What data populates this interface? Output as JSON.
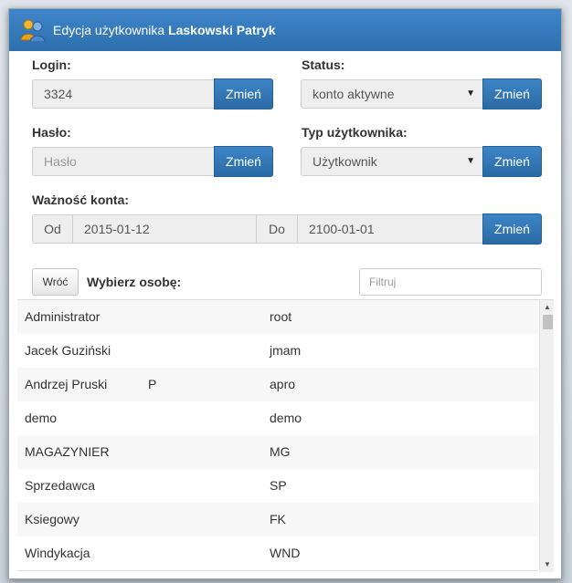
{
  "dialog": {
    "title_prefix": "Edycja użytkownika",
    "title_user": "Laskowski Patryk"
  },
  "form": {
    "login_label": "Login:",
    "login_value": "3324",
    "status_label": "Status:",
    "status_value": "konto aktywne",
    "password_label": "Hasło:",
    "password_placeholder": "Hasło",
    "user_type_label": "Typ użytkownika:",
    "user_type_value": "Użytkownik",
    "validity_label": "Ważność konta:",
    "from_label": "Od",
    "from_value": "2015-01-12",
    "to_label": "Do",
    "to_value": "2100-01-01",
    "change_label": "Zmień"
  },
  "picker": {
    "back_label": "Wróć",
    "heading": "Wybierz osobę:",
    "filter_placeholder": "Filtruj",
    "rows": [
      {
        "name": "Administrator",
        "mark": "",
        "login": "root"
      },
      {
        "name": "Jacek Guziński",
        "mark": "",
        "login": "jmam"
      },
      {
        "name": "Andrzej Pruski",
        "mark": "P",
        "login": "apro"
      },
      {
        "name": "demo",
        "mark": "",
        "login": "demo"
      },
      {
        "name": "MAGAZYNIER",
        "mark": "",
        "login": "MG"
      },
      {
        "name": "Sprzedawca",
        "mark": "",
        "login": "SP"
      },
      {
        "name": "Ksiegowy",
        "mark": "",
        "login": "FK"
      },
      {
        "name": "Windykacja",
        "mark": "",
        "login": "WND"
      }
    ]
  },
  "colors": {
    "accent": "#2d6fae",
    "title_text": "#ffffff"
  }
}
